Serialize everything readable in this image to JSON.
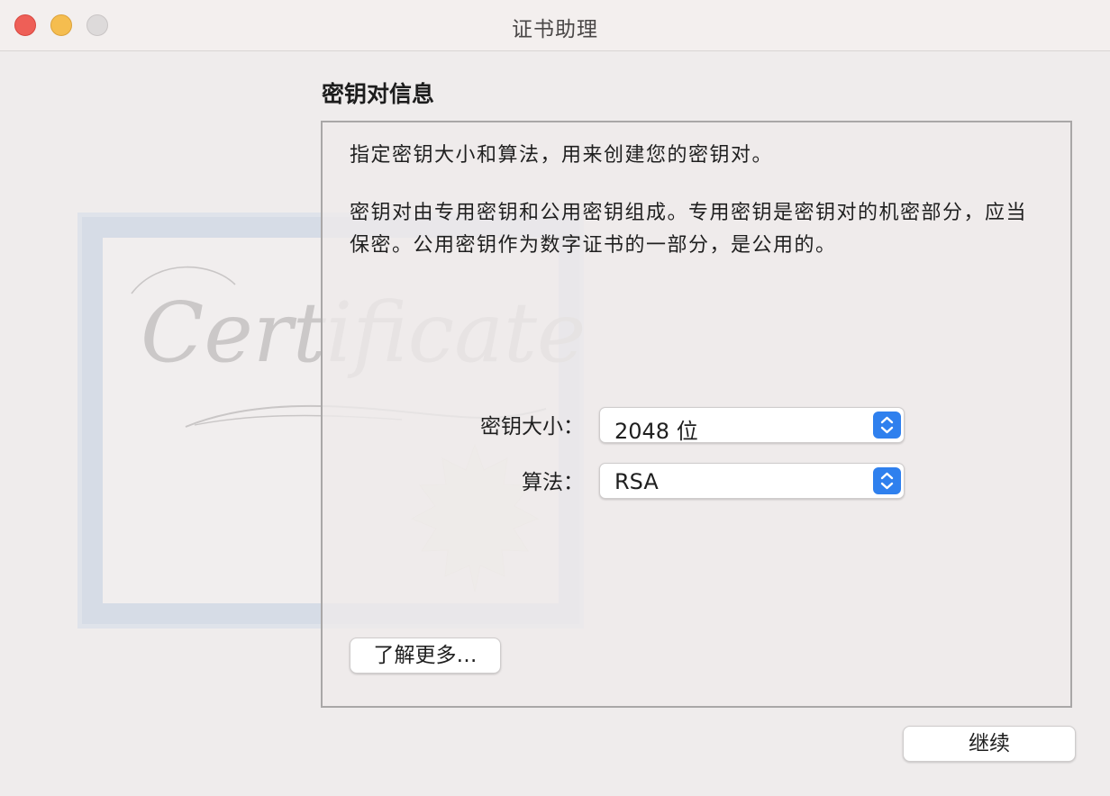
{
  "window": {
    "title": "证书助理"
  },
  "artwork": {
    "watermark_text": "Certificate"
  },
  "section": {
    "title": "密钥对信息"
  },
  "content": {
    "paragraph1": "指定密钥大小和算法，用来创建您的密钥对。",
    "paragraph2": "密钥对由专用密钥和公用密钥组成。专用密钥是密钥对的机密部分，应当保密。公用密钥作为数字证书的一部分，是公用的。"
  },
  "form": {
    "key_size_label": "密钥大小：",
    "key_size_value": "2048 位",
    "algorithm_label": "算法：",
    "algorithm_value": "RSA"
  },
  "buttons": {
    "learn_more": "了解更多…",
    "continue": "继续"
  },
  "colors": {
    "close": "#ee5f57",
    "minimize": "#f5bd4f",
    "zoom": "#dddada",
    "accent": "#2f80ee"
  },
  "icons": {
    "stepper": "up-down-chevron-icon"
  }
}
